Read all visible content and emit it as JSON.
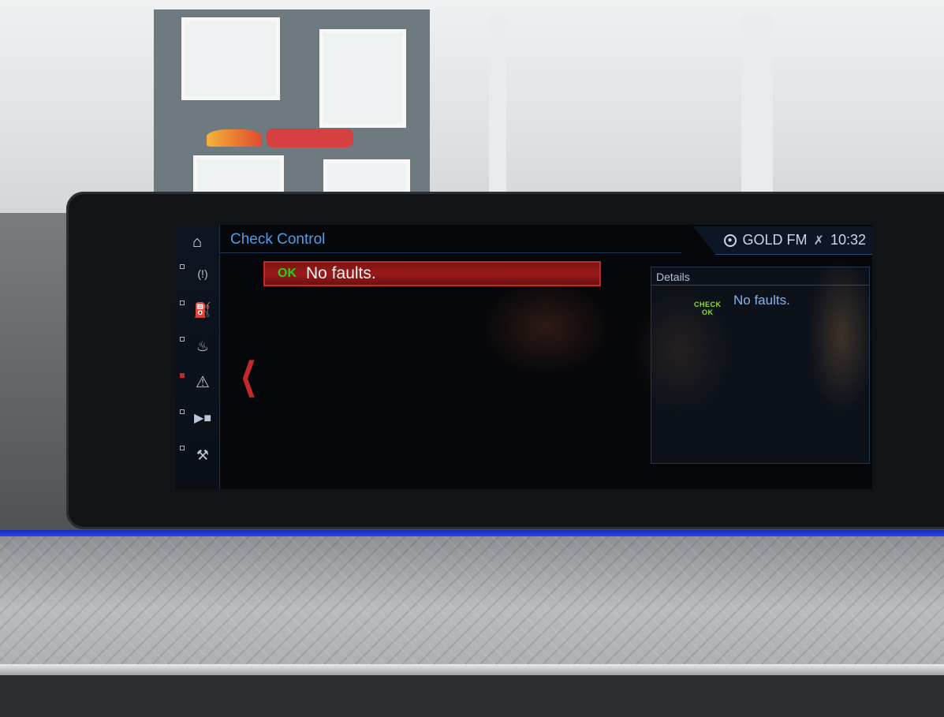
{
  "header": {
    "title": "Check Control"
  },
  "status_bar": {
    "station": "GOLD FM",
    "time": "10:32",
    "radio_icon": "radio-source-icon",
    "mute_icon": "mute-icon"
  },
  "rail": {
    "items": [
      {
        "name": "home-icon",
        "glyph": "⌂"
      },
      {
        "name": "tire-pressure-icon",
        "glyph": "(!)"
      },
      {
        "name": "oil-level-icon",
        "glyph": "⛽"
      },
      {
        "name": "coolant-icon",
        "glyph": "♨"
      },
      {
        "name": "warning-icon",
        "glyph": "⚠",
        "active": true
      },
      {
        "name": "vehicle-icon",
        "glyph": "🚗"
      },
      {
        "name": "service-icon",
        "glyph": "🔧"
      }
    ]
  },
  "message": {
    "status": "OK",
    "text": "No faults."
  },
  "details": {
    "label": "Details",
    "icon_top": "CHECK",
    "icon_bottom": "OK",
    "text": "No faults."
  },
  "colors": {
    "accent_blue": "#4f9de8",
    "alert_red": "#c02a2a",
    "ok_green": "#22d11e",
    "ambient_blue": "#2e44ff"
  }
}
